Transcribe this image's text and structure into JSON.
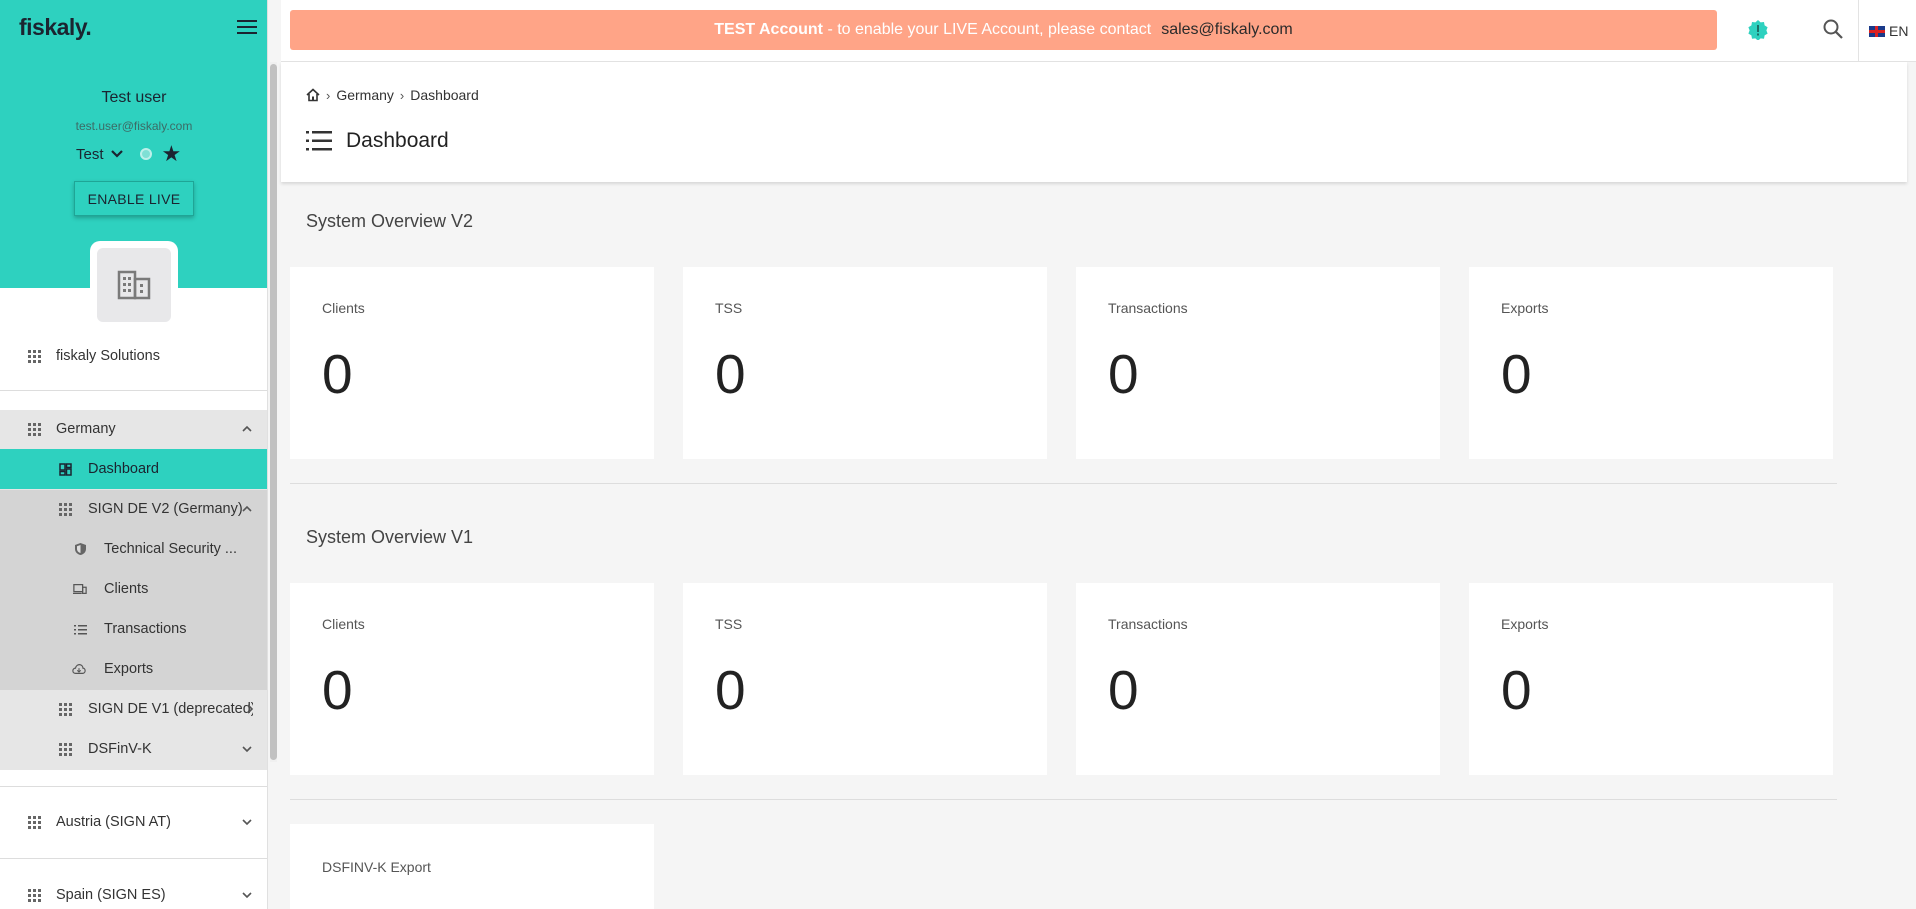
{
  "app": {
    "logo": "fiskaly."
  },
  "sidebar": {
    "user_name": "Test user",
    "user_email": "test.user@fiskaly.com",
    "environment": "Test",
    "enable_live_label": "ENABLE LIVE",
    "org_name": "fiskaly Solutions",
    "germany": "Germany",
    "dashboard": "Dashboard",
    "sign_de_v2": "SIGN DE V2 (Germany)",
    "tss": "Technical Security ...",
    "clients": "Clients",
    "transactions": "Transactions",
    "exports": "Exports",
    "sign_de_v1": "SIGN DE V1 (deprecated)",
    "dsfinvk": "DSFinV-K",
    "austria": "Austria (SIGN AT)",
    "spain": "Spain (SIGN ES)"
  },
  "topbar": {
    "banner_bold": "TEST Account",
    "banner_text": " - to enable your LIVE Account, please contact",
    "banner_email": "sales@fiskaly.com",
    "language": "EN"
  },
  "breadcrumb": {
    "country": "Germany",
    "page": "Dashboard"
  },
  "page_title": "Dashboard",
  "overview_v2": {
    "title": "System Overview V2",
    "cards": [
      {
        "label": "Clients",
        "value": "0"
      },
      {
        "label": "TSS",
        "value": "0"
      },
      {
        "label": "Transactions",
        "value": "0"
      },
      {
        "label": "Exports",
        "value": "0"
      }
    ]
  },
  "overview_v1": {
    "title": "System Overview V1",
    "cards": [
      {
        "label": "Clients",
        "value": "0"
      },
      {
        "label": "TSS",
        "value": "0"
      },
      {
        "label": "Transactions",
        "value": "0"
      },
      {
        "label": "Exports",
        "value": "0"
      }
    ]
  },
  "dsfinvk_export": {
    "label": "DSFINV-K Export"
  },
  "colors": {
    "brand": "#2ed1bf",
    "banner": "#ffa487",
    "active_nav": "#2ed1bf"
  }
}
